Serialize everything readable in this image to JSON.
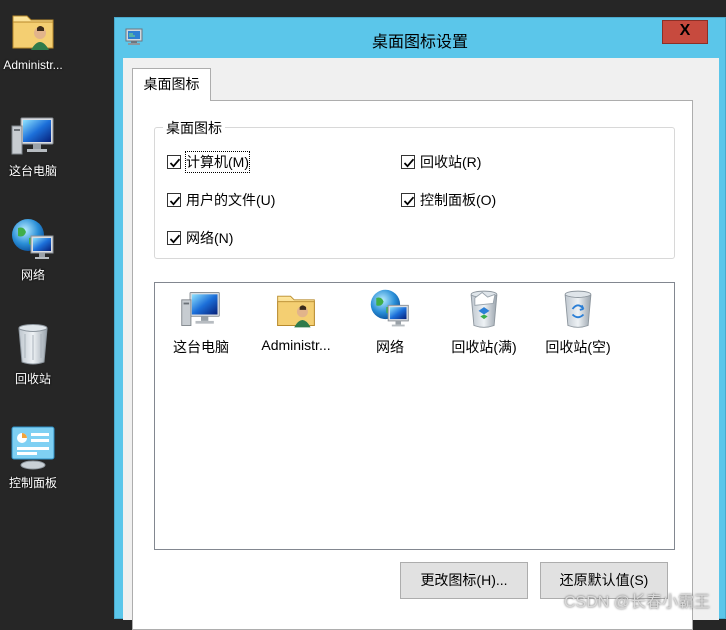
{
  "desktop": {
    "icons": [
      {
        "label": "Administr...",
        "icon": "user-folder-icon"
      },
      {
        "label": "这台电脑",
        "icon": "computer-icon"
      },
      {
        "label": "网络",
        "icon": "network-icon"
      },
      {
        "label": "回收站",
        "icon": "recycle-bin-icon"
      },
      {
        "label": "控制面板",
        "icon": "control-panel-icon"
      }
    ]
  },
  "dialog": {
    "title": "桌面图标设置",
    "close_label": "X",
    "tab_label": "桌面图标",
    "group_label": "桌面图标",
    "checkboxes": [
      {
        "label": "计算机(M)",
        "checked": true
      },
      {
        "label": "回收站(R)",
        "checked": true
      },
      {
        "label": "用户的文件(U)",
        "checked": true
      },
      {
        "label": "控制面板(O)",
        "checked": true
      },
      {
        "label": "网络(N)",
        "checked": true
      }
    ],
    "list_items": [
      {
        "label": "这台电脑",
        "icon": "computer-icon"
      },
      {
        "label": "Administr...",
        "icon": "user-folder-icon"
      },
      {
        "label": "网络",
        "icon": "network-icon"
      },
      {
        "label": "回收站(满)",
        "icon": "recycle-bin-full-icon"
      },
      {
        "label": "回收站(空)",
        "icon": "recycle-bin-empty-icon"
      }
    ],
    "change_icon_button": "更改图标(H)...",
    "restore_default_button": "还原默认值(S)"
  },
  "watermark": "CSDN @长春小霸王",
  "colors": {
    "titlebar": "#5bc6ea",
    "close_button": "#c74a3e",
    "desktop_background": "#262626"
  }
}
